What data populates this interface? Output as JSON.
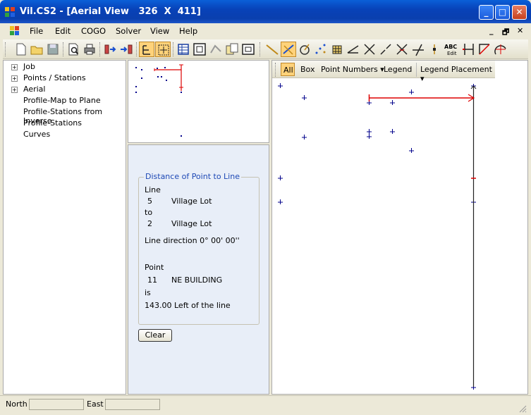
{
  "window": {
    "title": "Vil.CS2 - [Aerial View   326  X  411]",
    "min_glyph": "_",
    "max_glyph": "□",
    "close_glyph": "✕",
    "mdi_min": "_",
    "mdi_restore": "🗗",
    "mdi_close": "✕"
  },
  "menu": [
    "File",
    "Edit",
    "COGO",
    "Solver",
    "View",
    "Help"
  ],
  "tree": {
    "items": [
      {
        "label": "Job",
        "expandable": true
      },
      {
        "label": "Points / Stations",
        "expandable": true
      },
      {
        "label": "Aerial",
        "expandable": true
      },
      {
        "label": "Profile-Map to Plane",
        "expandable": false
      },
      {
        "label": "Profile-Stations from Inverse",
        "expandable": false
      },
      {
        "label": "Profile-Stations",
        "expandable": false
      },
      {
        "label": "Curves",
        "expandable": false
      }
    ]
  },
  "info": {
    "group_title": "Distance of Point to Line",
    "line_label": "Line",
    "from_num": "5",
    "from_name": "Village Lot",
    "to_label": "to",
    "to_num": "2",
    "to_name": "Village Lot",
    "direction": "Line direction   0° 00' 00''",
    "point_label": "Point",
    "point_num": "11",
    "point_name": "NE BUILDING",
    "is_label": "is",
    "result": "143.00   Left of the line",
    "clear_label": "Clear"
  },
  "viewbar": {
    "all": "All",
    "box": "Box",
    "point_numbers": "Point Numbers",
    "legend": "Legend",
    "legend_placement": "Legend Placement",
    "dropdown_glyph": "▾"
  },
  "status": {
    "north_label": "North",
    "north_value": "",
    "east_label": "East",
    "east_value": ""
  },
  "toolbar_icons": [
    "new-icon",
    "open-icon",
    "save-icon",
    "print-preview-icon",
    "print-icon",
    "import-icon",
    "export-icon",
    "select-icon",
    "zoom-extents-icon",
    "grid-icon",
    "frame-icon",
    "layers-icon",
    "copy-icon",
    "window-icon",
    "line-icon",
    "measure-line-icon",
    "circle-icon",
    "points-icon",
    "block-icon",
    "angle-icon",
    "intersect-icon",
    "line-split-icon",
    "cross-icon",
    "perpendicular-icon",
    "point-icon",
    "text-edit-icon",
    "offset-icon",
    "arc-icon",
    "compass-icon"
  ],
  "colors": {
    "title_blue": "#0a3fae",
    "accent_red": "#dd0000",
    "point_blue": "#00008b",
    "group_text": "#1d48b5"
  }
}
